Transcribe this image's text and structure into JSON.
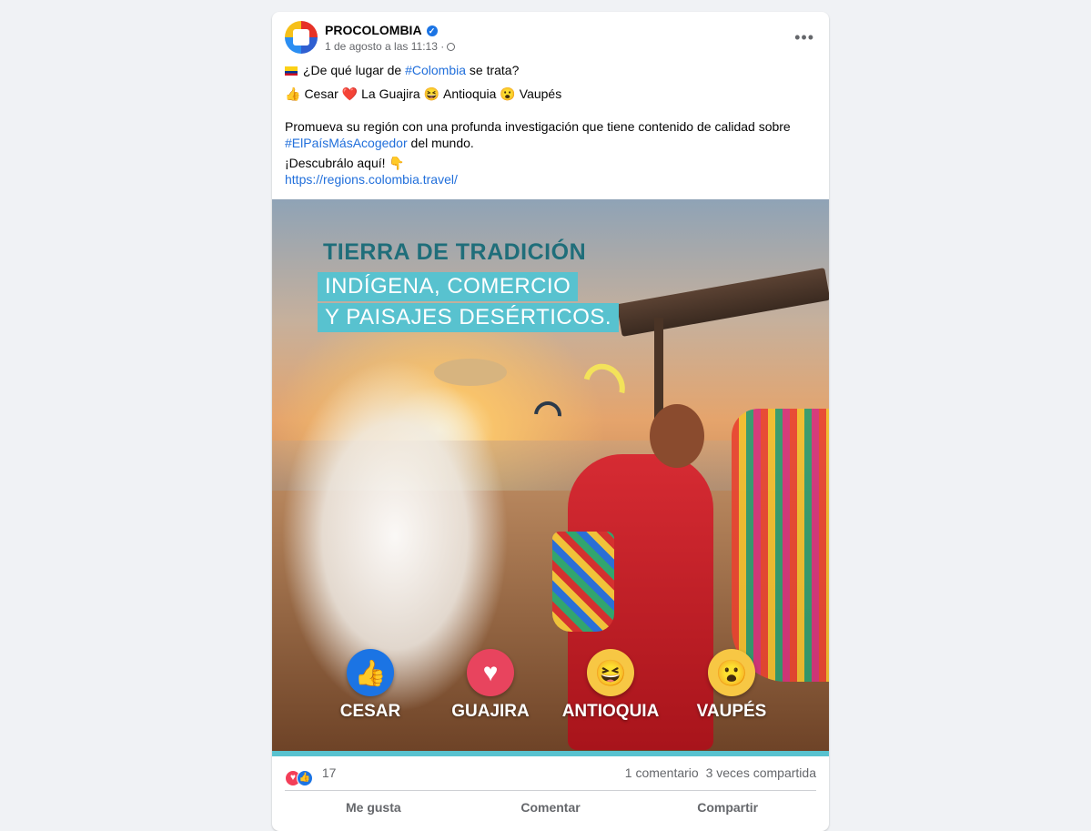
{
  "post": {
    "page_name": "PROCOLOMBIA",
    "verified_icon": "verified-check-icon",
    "timestamp": "1 de agosto a las 11:13 ·",
    "more_label": "•••",
    "text": {
      "line1_pre": "¿De qué lugar de ",
      "line1_tag": "#Colombia",
      "line1_post": " se trata?",
      "options": [
        {
          "emoji": "👍",
          "label": "Cesar"
        },
        {
          "emoji": "❤️",
          "label": "La Guajira"
        },
        {
          "emoji": "😆",
          "label": "Antioquia"
        },
        {
          "emoji": "😮",
          "label": "Vaupés"
        }
      ],
      "para1_pre": "Promueva su región con una profunda investigación que tiene contenido de calidad sobre ",
      "para1_tag": "#ElPaísMásAcogedor",
      "para1_post": " del mundo.",
      "cta": "¡Descubrálo aquí! 👇",
      "url": "https://regions.colombia.travel/"
    }
  },
  "image": {
    "title": "TIERRA DE TRADICIÓN",
    "band1": "INDÍGENA, COMERCIO",
    "band2": "Y PAISAJES DESÉRTICOS.",
    "reactions": [
      {
        "icon": "thumbs-up-icon",
        "glyph": "👍",
        "label": "CESAR",
        "color": "#1b74e4"
      },
      {
        "icon": "heart-icon",
        "glyph": "♥",
        "label": "GUAJIRA",
        "color": "#e8445e"
      },
      {
        "icon": "laughing-face-icon",
        "glyph": "😆",
        "label": "ANTIOQUIA",
        "color": "#f7c744"
      },
      {
        "icon": "wow-face-icon",
        "glyph": "😮",
        "label": "VAUPÉS",
        "color": "#f7c744"
      }
    ]
  },
  "stats": {
    "reaction_count": "17",
    "comments": "1 comentario",
    "shares": "3 veces compartida"
  },
  "actions": [
    "Me gusta",
    "Comentar",
    "Compartir"
  ]
}
